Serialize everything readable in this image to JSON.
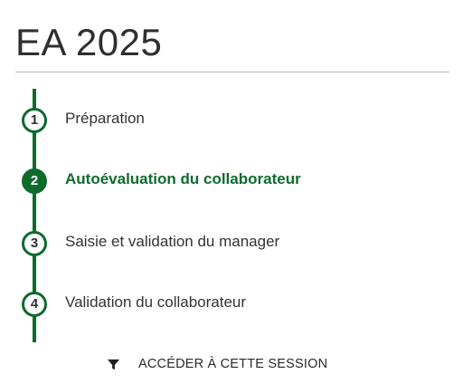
{
  "session": {
    "title": "EA 2025"
  },
  "steps": [
    {
      "number": "1",
      "label": "Préparation",
      "active": false
    },
    {
      "number": "2",
      "label": "Autoévaluation du collaborateur",
      "active": true
    },
    {
      "number": "3",
      "label": "Saisie et validation du manager",
      "active": false
    },
    {
      "number": "4",
      "label": "Validation du collaborateur",
      "active": false
    }
  ],
  "action": {
    "label": "ACCÉDER À CETTE SESSION",
    "icon": "filter-icon"
  },
  "colors": {
    "accent": "#0e6b2c",
    "text": "#333333",
    "divider": "#b9b9b9"
  }
}
